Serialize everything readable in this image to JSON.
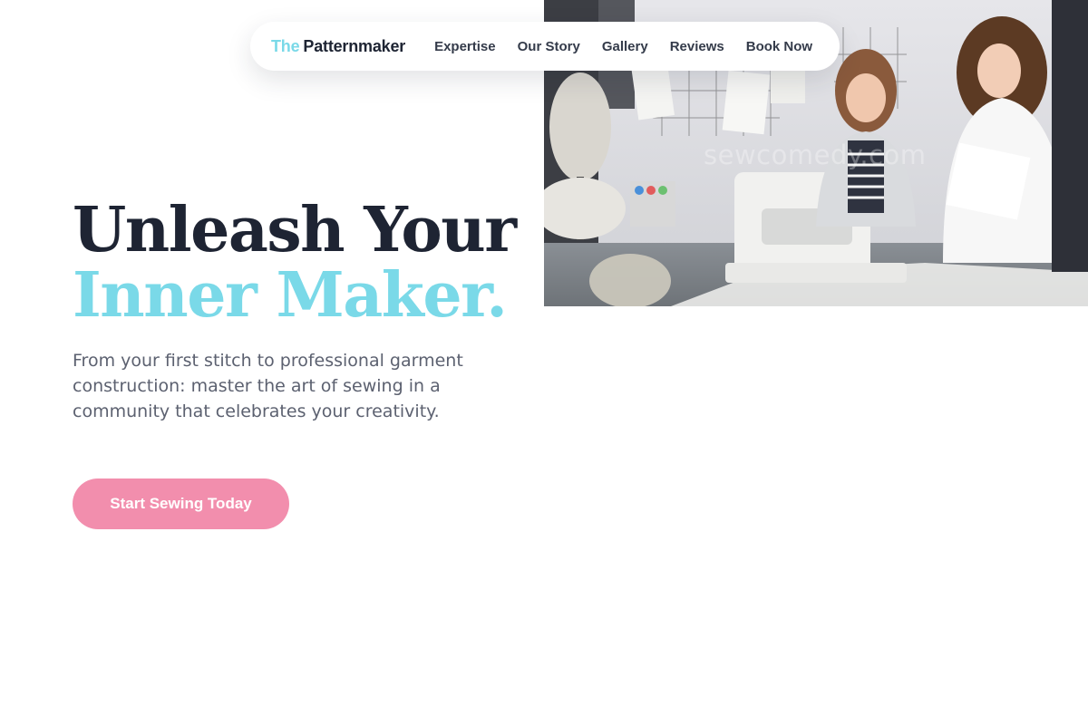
{
  "brand": {
    "prefix": "The",
    "name": "Patternmaker",
    "accent_color": "#7ad9e8"
  },
  "nav": {
    "links": [
      {
        "label": "Expertise"
      },
      {
        "label": "Our Story"
      },
      {
        "label": "Gallery"
      },
      {
        "label": "Reviews"
      },
      {
        "label": "Book Now"
      }
    ]
  },
  "hero": {
    "headline_line1": "Unleash Your",
    "headline_line2": "Inner Maker.",
    "subtext": "From your first stitch to professional garment construction: master the art of sewing in a community that celebrates your creativity.",
    "cta_label": "Start Sewing Today",
    "cta_color": "#f28ead"
  },
  "photo": {
    "watermark": "sewcomedy.com"
  }
}
